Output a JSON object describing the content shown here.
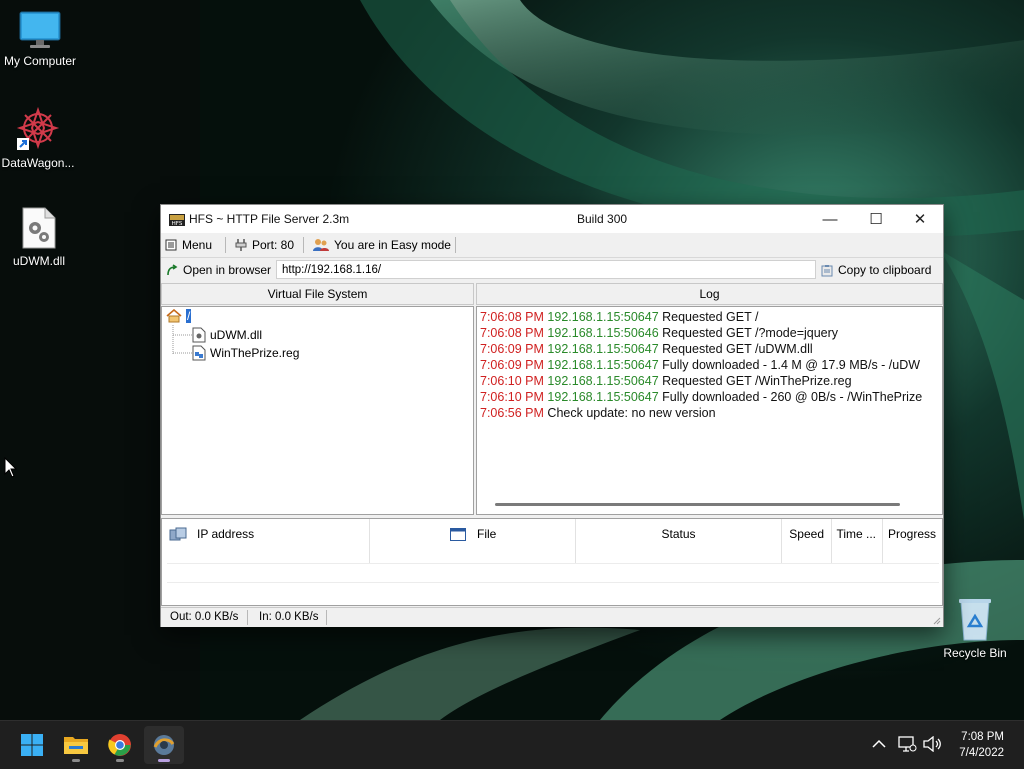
{
  "desktop": {
    "icons": [
      {
        "label": "My Computer",
        "icon": "monitor-icon"
      },
      {
        "label": "DataWagon...",
        "icon": "datawagon-shortcut-icon"
      },
      {
        "label": "uDWM.dll",
        "icon": "dll-file-icon"
      },
      {
        "label": "Recycle Bin",
        "icon": "recycle-bin-icon"
      }
    ]
  },
  "window": {
    "title": "HFS ~ HTTP File Server 2.3m",
    "build": "Build 300",
    "controls": {
      "minimize": "—",
      "maximize": "☐",
      "close": "✕"
    },
    "toolbar": {
      "menu": "Menu",
      "port": "Port: 80",
      "mode": "You are in Easy mode"
    },
    "urlbar": {
      "open_label": "Open in browser",
      "url": "http://192.168.1.16/",
      "copy_label": "Copy to clipboard"
    },
    "vfs": {
      "header": "Virtual File System",
      "root": "/",
      "files": [
        "uDWM.dll",
        "WinThePrize.reg"
      ]
    },
    "log": {
      "header": "Log",
      "entries": [
        {
          "time": "7:06:08 PM",
          "ip": "192.168.1.15:50647",
          "msg": "Requested GET /"
        },
        {
          "time": "7:06:08 PM",
          "ip": "192.168.1.15:50646",
          "msg": "Requested GET /?mode=jquery"
        },
        {
          "time": "7:06:09 PM",
          "ip": "192.168.1.15:50647",
          "msg": "Requested GET /uDWM.dll"
        },
        {
          "time": "7:06:09 PM",
          "ip": "192.168.1.15:50647",
          "msg": "Fully downloaded - 1.4 M @ 17.9 MB/s - /uDW"
        },
        {
          "time": "7:06:10 PM",
          "ip": "192.168.1.15:50647",
          "msg": "Requested GET /WinThePrize.reg"
        },
        {
          "time": "7:06:10 PM",
          "ip": "192.168.1.15:50647",
          "msg": "Fully downloaded - 260 @ 0B/s - /WinThePrize"
        },
        {
          "time": "7:06:56 PM",
          "ip": "",
          "msg": "Check update: no new version"
        }
      ]
    },
    "connections": {
      "columns": [
        "IP address",
        "File",
        "Status",
        "Speed",
        "Time ...",
        "Progress"
      ]
    },
    "statusbar": {
      "out": "Out: 0.0 KB/s",
      "in": "In: 0.0 KB/s"
    }
  },
  "taskbar": {
    "apps": [
      "windows-start-icon",
      "file-explorer-icon",
      "chrome-icon",
      "hfs-icon"
    ],
    "tray": {
      "time": "7:08 PM",
      "date": "7/4/2022"
    }
  },
  "colors": {
    "log_time": "#d02020",
    "log_ip": "#2a8a2a",
    "taskbar": "#1f1f1f"
  }
}
